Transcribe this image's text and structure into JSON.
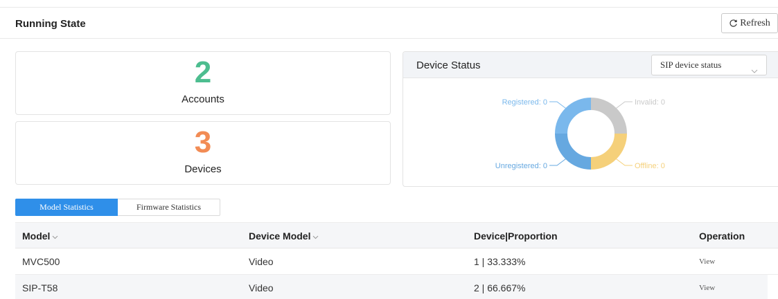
{
  "header": {
    "title": "Running State",
    "refresh_label": "Refresh"
  },
  "stats": [
    {
      "value": "2",
      "label": "Accounts",
      "color": "#4dbd8f"
    },
    {
      "value": "3",
      "label": "Devices",
      "color": "#f28c55"
    }
  ],
  "device_status": {
    "title": "Device Status",
    "select_value": "SIP device status",
    "segments": [
      {
        "label": "Registered: 0",
        "color": "#7ab8ec"
      },
      {
        "label": "Invalid: 0",
        "color": "#c9c9c9"
      },
      {
        "label": "Offline: 0",
        "color": "#f5d07a"
      },
      {
        "label": "Unregistered: 0",
        "color": "#66a8e0"
      }
    ]
  },
  "tabs": [
    {
      "label": "Model Statistics",
      "active": true
    },
    {
      "label": "Firmware Statistics",
      "active": false
    }
  ],
  "table": {
    "columns": [
      "Model",
      "Device Model",
      "Device|Proportion",
      "Operation"
    ],
    "rows": [
      {
        "model": "MVC500",
        "device_model": "Video",
        "proportion": "1 | 33.333%",
        "operation": "View"
      },
      {
        "model": "SIP-T58",
        "device_model": "Video",
        "proportion": "2 | 66.667%",
        "operation": "View"
      }
    ]
  }
}
